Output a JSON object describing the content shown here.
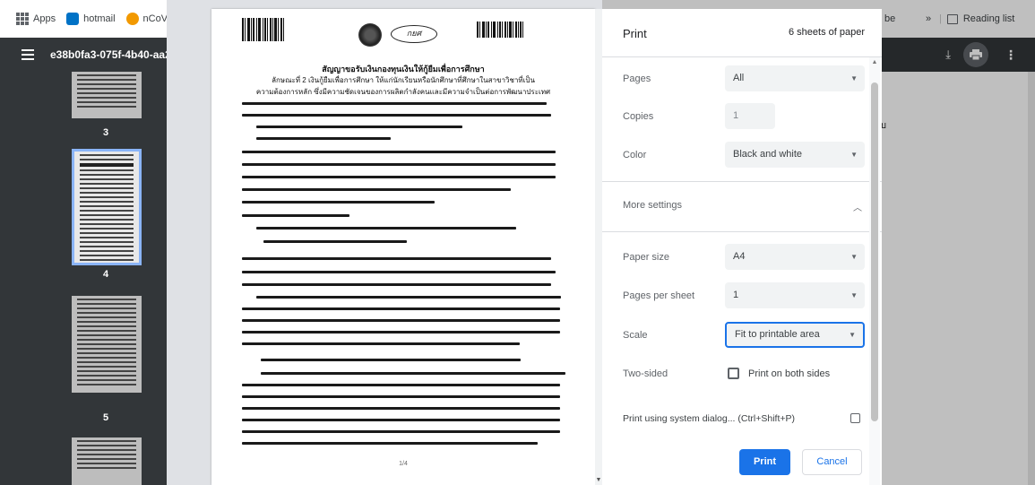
{
  "bookmarks": {
    "apps_label": "Apps",
    "hotmail_label": "hotmail",
    "ncov_label": "nCoV",
    "partial_right": "be",
    "overflow": "»",
    "reading_list": "Reading list"
  },
  "pdf_toolbar": {
    "file_title": "e38b0fa3-075f-4b40-aa2"
  },
  "thumbnails": {
    "items": [
      {
        "number": "3"
      },
      {
        "number": "4"
      },
      {
        "number": "5"
      }
    ]
  },
  "page_edge_text": "ทบ",
  "preview": {
    "doc_title_line1": "สัญญาขอรับเงินกองทุนเงินให้กู้ยืมเพื่อการศึกษา",
    "doc_title_line2": "ลักษณะที่ 2 เงินกู้ยืมเพื่อการศึกษา ให้แก่นักเรียนหรือนักศึกษาที่ศึกษาในสาขาวิชาที่เป็น",
    "doc_title_line3": "ความต้องการหลัก ซึ่งมีความชัดเจนของการผลิตกำลังคนและมีความจำเป็นต่อการพัฒนาประเทศ",
    "logo_text": "กยศ",
    "page_footer": "1/4"
  },
  "print_panel": {
    "title": "Print",
    "sheet_count": "6 sheets of paper",
    "pages_label": "Pages",
    "pages_value": "All",
    "copies_label": "Copies",
    "copies_value": "1",
    "color_label": "Color",
    "color_value": "Black and white",
    "more_settings_label": "More settings",
    "paper_size_label": "Paper size",
    "paper_size_value": "A4",
    "pages_per_sheet_label": "Pages per sheet",
    "pages_per_sheet_value": "1",
    "scale_label": "Scale",
    "scale_value": "Fit to printable area",
    "two_sided_label": "Two-sided",
    "two_sided_option": "Print on both sides",
    "system_dialog_label": "Print using system dialog... (Ctrl+Shift+P)",
    "print_button": "Print",
    "cancel_button": "Cancel"
  },
  "icons": {
    "apps": "apps-grid-icon",
    "hotmail": "outlook-icon",
    "ncov": "ncov-icon",
    "reading_list": "reading-list-icon",
    "menu": "hamburger-icon",
    "download": "download-icon",
    "print": "print-icon",
    "more": "more-vert-icon",
    "open_external": "open-external-icon"
  },
  "colors": {
    "accent": "#1a73e8",
    "toolbar": "#323639",
    "sidebar": "#323639",
    "hotmail_icon": "#0072c6",
    "ncov_icon": "#f29900"
  }
}
